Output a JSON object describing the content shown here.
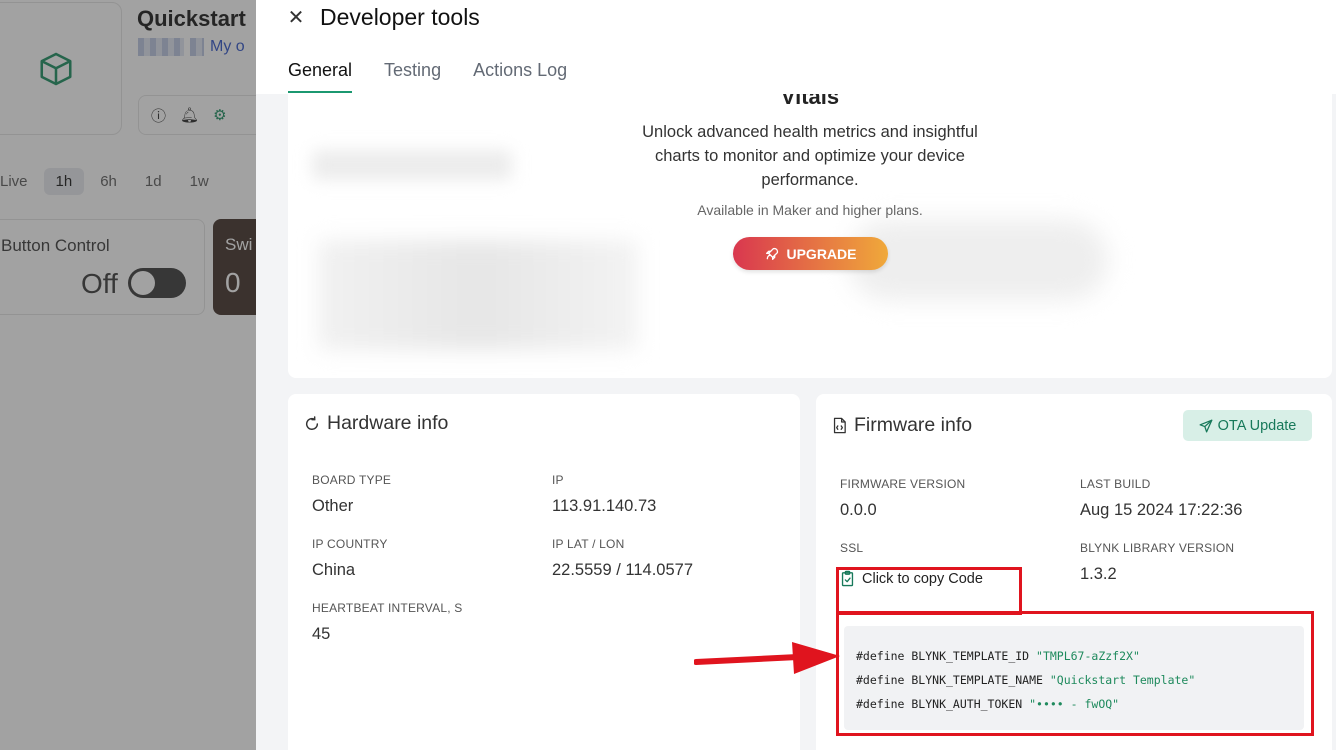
{
  "background": {
    "title": "Quickstart",
    "owner_label": "My o",
    "time_ranges": [
      "Live",
      "1h",
      "6h",
      "1d",
      "1w"
    ],
    "button_card": {
      "label": "Button Control",
      "value": "Off"
    },
    "switch_card": {
      "label": "Swi",
      "value": "0"
    }
  },
  "drawer": {
    "title": "Developer tools",
    "tabs": [
      "General",
      "Testing",
      "Actions Log"
    ]
  },
  "vitals": {
    "title": "Vitals",
    "description": "Unlock advanced health metrics and insightful charts to monitor and optimize your device performance.",
    "subtext": "Available in Maker and higher plans.",
    "upgrade_label": "UPGRADE"
  },
  "hardware": {
    "title": "Hardware info",
    "board_type_label": "BOARD TYPE",
    "board_type": "Other",
    "ip_label": "IP",
    "ip": "113.91.140.73",
    "ip_country_label": "IP COUNTRY",
    "ip_country": "China",
    "ip_latlon_label": "IP LAT / LON",
    "ip_latlon": "22.5559 / 114.0577",
    "heartbeat_label": "HEARTBEAT INTERVAL, S",
    "heartbeat": "45"
  },
  "firmware": {
    "title": "Firmware info",
    "ota_label": "OTA Update",
    "version_label": "FIRMWARE VERSION",
    "version": "0.0.0",
    "last_build_label": "LAST BUILD",
    "last_build": "Aug 15 2024 17:22:36",
    "ssl_label": "SSL",
    "library_label": "BLYNK LIBRARY VERSION",
    "library_version": "1.3.2",
    "copy_label": "Click to copy Code",
    "code_lines": [
      {
        "prefix": "#define BLYNK_TEMPLATE_ID ",
        "value": "\"TMPL67-aZzf2X\""
      },
      {
        "prefix": "#define BLYNK_TEMPLATE_NAME ",
        "value": "\"Quickstart Template\""
      },
      {
        "prefix": "#define BLYNK_AUTH_TOKEN ",
        "value": "\"•••• - fwOQ\""
      }
    ]
  },
  "colors": {
    "accent": "#1b9870",
    "annotation_red": "#e0141e",
    "upgrade_start": "#d9374f",
    "upgrade_end": "#f0a93a"
  }
}
